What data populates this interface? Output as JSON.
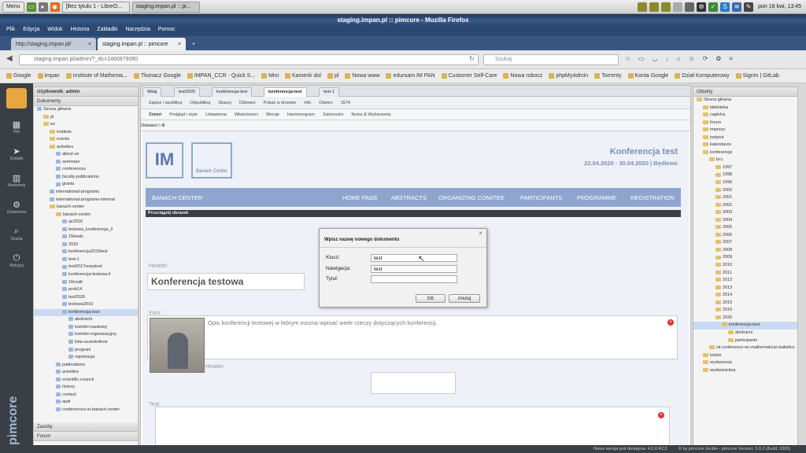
{
  "taskbar": {
    "menu": "Menu",
    "window1": "[Bez tytułu 1 - LibreO...",
    "window2": "staging.impan.pl :: pi...",
    "clock": "pon 18 kwi, 13:45"
  },
  "firefox": {
    "title": "staging.impan.pl :: pimcore - Mozilla Firefox",
    "menu": [
      "Plik",
      "Edycja",
      "Widok",
      "Historia",
      "Zakładki",
      "Narzędzia",
      "Pomoc"
    ],
    "tabs": [
      "http://staging.impan.pl/",
      "staging.impan.pl :: pimcore"
    ],
    "url": "staging.impan.pl/admin/?_dc=1460979080",
    "search_placeholder": "Szukaj",
    "bookmarks": [
      "Google",
      "impan",
      "Institute of Mathema...",
      "Tłumacz Google",
      "IMPAN_CCR - Quick S...",
      "Mini",
      "Kamerki dol",
      "pl",
      "Nowa www",
      "eduroam IM PAN",
      "Customer Self-Care",
      "Nowa robocz",
      "phpMyAdmin",
      "Torrenty",
      "Konta Google",
      "Dział Komputerowy",
      "SignIn | GitLab"
    ]
  },
  "pimcore": {
    "nav": [
      {
        "icon": "▦",
        "label": "Plik"
      },
      {
        "icon": "➤",
        "label": "Dodatki"
      },
      {
        "icon": "▥",
        "label": "Marketing"
      },
      {
        "icon": "⚙",
        "label": "Ustawienia"
      },
      {
        "icon": "⌕",
        "label": "Szukaj"
      },
      {
        "icon": "⏻",
        "label": "Wyloguj"
      }
    ],
    "brand": "pimcore",
    "user": "Użytkownik: admin",
    "docs_panel": "Dokumenty",
    "tree": [
      {
        "label": "Strona główna",
        "d": 0,
        "f": 0
      },
      {
        "label": "pl",
        "d": 1,
        "f": 1
      },
      {
        "label": "en",
        "d": 1,
        "f": 1
      },
      {
        "label": "institute",
        "d": 2,
        "f": 1
      },
      {
        "label": "events",
        "d": 2,
        "f": 1
      },
      {
        "label": "activities",
        "d": 2,
        "f": 1
      },
      {
        "label": "about-us",
        "d": 3,
        "f": 0
      },
      {
        "label": "seminars",
        "d": 3,
        "f": 0
      },
      {
        "label": "conferences",
        "d": 3,
        "f": 0
      },
      {
        "label": "faculty-publications",
        "d": 3,
        "f": 0
      },
      {
        "label": "grants",
        "d": 3,
        "f": 0
      },
      {
        "label": "international-programs",
        "d": 2,
        "f": 0
      },
      {
        "label": "international-programs-internal",
        "d": 2,
        "f": 0
      },
      {
        "label": "banach-center",
        "d": 2,
        "f": 1
      },
      {
        "label": "banach-center",
        "d": 3,
        "f": 1
      },
      {
        "label": "qc2016",
        "d": 4,
        "f": 0
      },
      {
        "label": "testowa_konferencja_li",
        "d": 4,
        "f": 0
      },
      {
        "label": "15kwds",
        "d": 4,
        "f": 0
      },
      {
        "label": "2016",
        "d": 4,
        "f": 0
      },
      {
        "label": "konferencja2016test",
        "d": 4,
        "f": 0
      },
      {
        "label": "test-1",
        "d": 4,
        "f": 0
      },
      {
        "label": "test2017nowytest",
        "d": 4,
        "f": 0
      },
      {
        "label": "konferencja-testowa-li",
        "d": 4,
        "f": 0
      },
      {
        "label": "16multi",
        "d": 4,
        "f": 0
      },
      {
        "label": "prob14",
        "d": 4,
        "f": 0
      },
      {
        "label": "test2020",
        "d": 4,
        "f": 0
      },
      {
        "label": "testowa2016",
        "d": 4,
        "f": 0
      },
      {
        "label": "konferencja-test",
        "d": 4,
        "f": 0,
        "sel": true
      },
      {
        "label": "abstracts",
        "d": 5,
        "f": 0
      },
      {
        "label": "komitet-naukowy",
        "d": 5,
        "f": 0
      },
      {
        "label": "komitet-organizacyjny",
        "d": 5,
        "f": 0
      },
      {
        "label": "lista-uczestnikow",
        "d": 5,
        "f": 0
      },
      {
        "label": "program",
        "d": 5,
        "f": 0
      },
      {
        "label": "rejestracja",
        "d": 5,
        "f": 0
      },
      {
        "label": "publications",
        "d": 3,
        "f": 0
      },
      {
        "label": "activities",
        "d": 3,
        "f": 0
      },
      {
        "label": "scientific-council",
        "d": 3,
        "f": 0
      },
      {
        "label": "history",
        "d": 3,
        "f": 0
      },
      {
        "label": "contact",
        "d": 3,
        "f": 0
      },
      {
        "label": "epdi",
        "d": 3,
        "f": 0
      },
      {
        "label": "conferences-in-banach-center",
        "d": 3,
        "f": 0
      }
    ],
    "zasoby": "Zasoby",
    "forum": "Forum",
    "doc_tabs": [
      "Witaj",
      "test2020",
      "konferencja-test",
      "konferencja-test",
      "test-1"
    ],
    "toolbar1": [
      "Zapisz i opublikuj",
      "Odpublikuj",
      "Skasuj",
      "Odśwież",
      "Pokaż w drzewie",
      "Info",
      "Otwórz",
      "1574"
    ],
    "toolbar2": [
      "Zmień",
      "Podgląd i style",
      "Ustawienia",
      "Właściwości",
      "Wersje",
      "Harmonogram",
      "Zależności",
      "Notes & Wydarzenia"
    ],
    "toolbar3": [
      "Odśwież"
    ],
    "page": {
      "logo_text": "Banach Center",
      "conf_title": "Konferencja test",
      "conf_date": "22.04.2020 - 30.04.2020 | Będlewo",
      "nav_home": "BANACH CENTER",
      "nav": [
        "HOME PAGE",
        "ABSTRACTS",
        "ORGANIZING COMITEE",
        "PARTICIPANTS",
        "PROGRAMME",
        "REGISTRATION"
      ],
      "drag": "Przeciągnij obrazek",
      "header_label": "Header:",
      "heading": "Konferencja testowa",
      "intro_label": "Intro:",
      "intro_text": "Opis konferencji testowej w którym mozna wpisać wiele rzeczy dotyczących konferencji.",
      "header2_label": "Header:",
      "text_label": "Text:"
    },
    "objects_panel": "Obiekty",
    "objects": [
      {
        "label": "Strona główna",
        "d": 0
      },
      {
        "label": "biblioteka",
        "d": 1
      },
      {
        "label": "captcha",
        "d": 1
      },
      {
        "label": "forum",
        "d": 1
      },
      {
        "label": "imprezy",
        "d": 1
      },
      {
        "label": "instytut",
        "d": 1
      },
      {
        "label": "kalendarze",
        "d": 1
      },
      {
        "label": "konferencje",
        "d": 1
      },
      {
        "label": "bcc",
        "d": 2
      },
      {
        "label": "1997",
        "d": 3
      },
      {
        "label": "1998",
        "d": 3
      },
      {
        "label": "1999",
        "d": 3
      },
      {
        "label": "2000",
        "d": 3
      },
      {
        "label": "2001",
        "d": 3
      },
      {
        "label": "2002",
        "d": 3
      },
      {
        "label": "2003",
        "d": 3
      },
      {
        "label": "2004",
        "d": 3
      },
      {
        "label": "2005",
        "d": 3
      },
      {
        "label": "2006",
        "d": 3
      },
      {
        "label": "2007",
        "d": 3
      },
      {
        "label": "2008",
        "d": 3
      },
      {
        "label": "2009",
        "d": 3
      },
      {
        "label": "2010",
        "d": 3
      },
      {
        "label": "2011",
        "d": 3
      },
      {
        "label": "2012",
        "d": 3
      },
      {
        "label": "2013",
        "d": 3
      },
      {
        "label": "2014",
        "d": 3
      },
      {
        "label": "2015",
        "d": 3
      },
      {
        "label": "2016",
        "d": 3
      },
      {
        "label": "2020",
        "d": 3
      },
      {
        "label": "konferencja-test",
        "d": 4,
        "sel": true
      },
      {
        "label": "abstracts",
        "d": 5
      },
      {
        "label": "participants",
        "d": 5
      },
      {
        "label": "xii-conference-on-mathematical-statistics",
        "d": 2
      },
      {
        "label": "ludzie",
        "d": 1
      },
      {
        "label": "wydarzenia",
        "d": 1
      },
      {
        "label": "wydawnictwa",
        "d": 1
      }
    ],
    "status_left": "Nowa wersja jest dostępna: 4.0.0.RC2",
    "status_right": "© by pimcore GmbH - pimcore Version: 3.0.2 (Build: 3365)"
  },
  "dialog": {
    "title": "Wpisz nazwę nowego dokumentu",
    "klucz_label": "Klucz:",
    "klucz_value": "test",
    "nav_label": "Nawigacja:",
    "nav_value": "test",
    "tytul_label": "Tytuł:",
    "tytul_value": "",
    "ok": "OK",
    "cancel": "Anuluj"
  }
}
